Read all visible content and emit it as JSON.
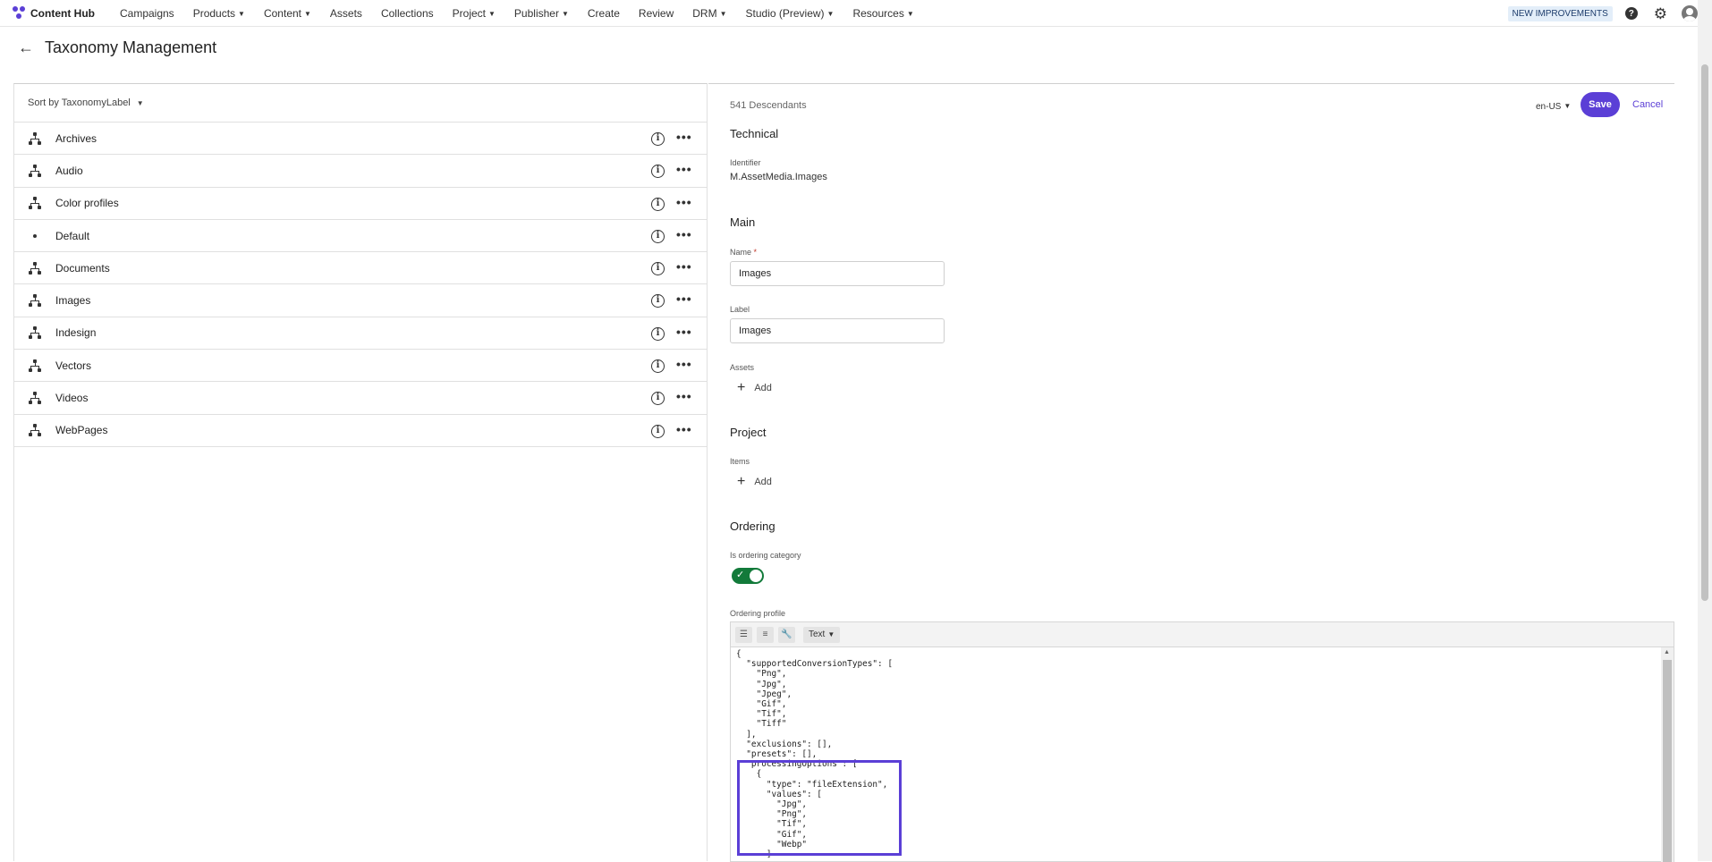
{
  "app": {
    "name": "Content Hub",
    "brand_color": "#5b3fd6"
  },
  "nav": {
    "items": [
      {
        "label": "Campaigns",
        "caret": false
      },
      {
        "label": "Products",
        "caret": true
      },
      {
        "label": "Content",
        "caret": true
      },
      {
        "label": "Assets",
        "caret": false
      },
      {
        "label": "Collections",
        "caret": false
      },
      {
        "label": "Project",
        "caret": true
      },
      {
        "label": "Publisher",
        "caret": true
      },
      {
        "label": "Create",
        "caret": false
      },
      {
        "label": "Review",
        "caret": false
      },
      {
        "label": "DRM",
        "caret": true
      },
      {
        "label": "Studio (Preview)",
        "caret": true
      },
      {
        "label": "Resources",
        "caret": true
      }
    ],
    "new_improvements": "NEW IMPROVEMENTS",
    "help_glyph": "?"
  },
  "page": {
    "title": "Taxonomy Management"
  },
  "left": {
    "sort_label": "Sort by TaxonomyLabel",
    "items": [
      {
        "label": "Archives",
        "icon": "tree-icon"
      },
      {
        "label": "Audio",
        "icon": "tree-icon"
      },
      {
        "label": "Color profiles",
        "icon": "tree-icon"
      },
      {
        "label": "Default",
        "icon": "dot-icon"
      },
      {
        "label": "Documents",
        "icon": "tree-icon"
      },
      {
        "label": "Images",
        "icon": "tree-icon"
      },
      {
        "label": "Indesign",
        "icon": "tree-icon"
      },
      {
        "label": "Vectors",
        "icon": "tree-icon"
      },
      {
        "label": "Videos",
        "icon": "tree-icon"
      },
      {
        "label": "WebPages",
        "icon": "tree-icon"
      }
    ]
  },
  "detail": {
    "descendants": "541 Descendants",
    "language": "en-US",
    "save_label": "Save",
    "cancel_label": "Cancel",
    "technical": {
      "title": "Technical",
      "identifier_label": "Identifier",
      "identifier_value": "M.AssetMedia.Images"
    },
    "main": {
      "title": "Main",
      "name_label": "Name",
      "name_value": "Images",
      "label_label": "Label",
      "label_value": "Images",
      "assets_label": "Assets",
      "add_label": "Add"
    },
    "project": {
      "title": "Project",
      "items_label": "Items",
      "add_label": "Add"
    },
    "ordering": {
      "title": "Ordering",
      "is_ordering_label": "Is ordering category",
      "is_ordering": true,
      "profile_label": "Ordering profile",
      "mode": "Text",
      "code": "{\n  \"supportedConversionTypes\": [\n    \"Png\",\n    \"Jpg\",\n    \"Jpeg\",\n    \"Gif\",\n    \"Tif\",\n    \"Tiff\"\n  ],\n  \"exclusions\": [],\n  \"presets\": [],\n  \"processingOptions\": [\n    {\n      \"type\": \"fileExtension\",\n      \"values\": [\n        \"Jpg\",\n        \"Png\",\n        \"Tif\",\n        \"Gif\",\n        \"Webp\"\n      ]"
    }
  }
}
